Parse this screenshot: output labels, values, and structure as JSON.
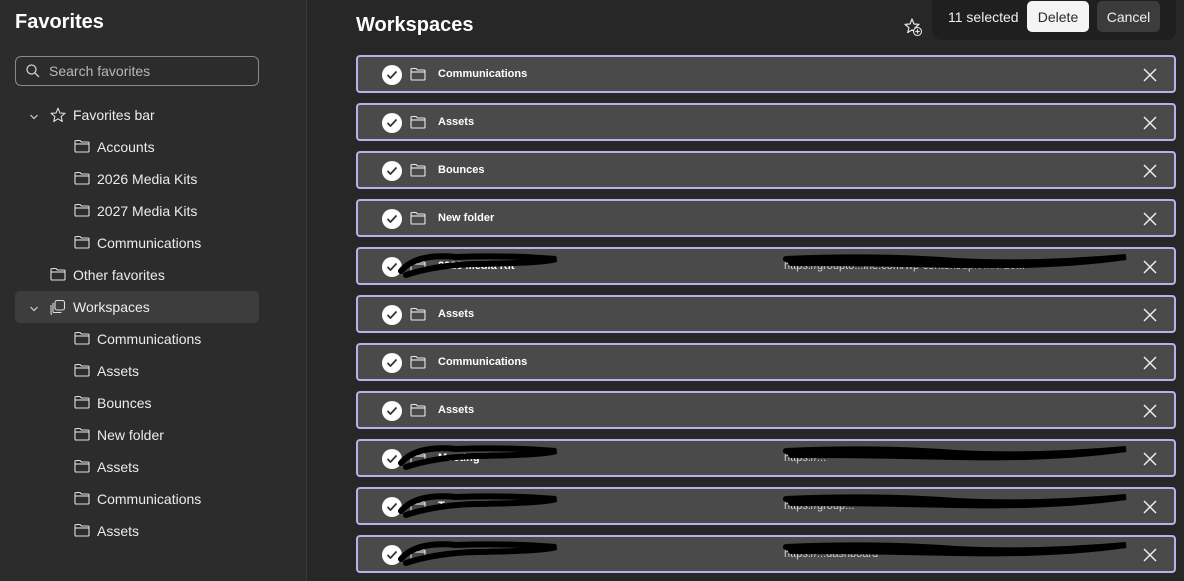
{
  "sidebar": {
    "title": "Favorites",
    "search_placeholder": "Search favorites",
    "tree": [
      {
        "label": "Favorites bar",
        "icon": "star-icon",
        "level": 0,
        "expanded": true
      },
      {
        "label": "Accounts",
        "icon": "folder-icon",
        "level": 1
      },
      {
        "label": "2026 Media Kits",
        "icon": "folder-icon",
        "level": 1
      },
      {
        "label": "2027 Media Kits",
        "icon": "folder-icon",
        "level": 1
      },
      {
        "label": "Communications",
        "icon": "folder-icon",
        "level": 1
      },
      {
        "label": "Other favorites",
        "icon": "folder-icon",
        "level": 0
      },
      {
        "label": "Workspaces",
        "icon": "workspaces-icon",
        "level": 0,
        "expanded": true,
        "selected": true
      },
      {
        "label": "Communications",
        "icon": "folder-icon",
        "level": 1
      },
      {
        "label": "Assets",
        "icon": "folder-icon",
        "level": 1
      },
      {
        "label": "Bounces",
        "icon": "folder-icon",
        "level": 1
      },
      {
        "label": "New folder",
        "icon": "folder-icon",
        "level": 1
      },
      {
        "label": "Assets",
        "icon": "folder-icon",
        "level": 1
      },
      {
        "label": "Communications",
        "icon": "folder-icon",
        "level": 1
      },
      {
        "label": "Assets",
        "icon": "folder-icon",
        "level": 1
      }
    ]
  },
  "main": {
    "title": "Workspaces",
    "selection": {
      "count_label": "11 selected",
      "delete_label": "Delete",
      "cancel_label": "Cancel"
    },
    "rows": [
      {
        "name": "Communications",
        "type": "folder",
        "url": ""
      },
      {
        "name": "Assets",
        "type": "folder",
        "url": ""
      },
      {
        "name": "Bounces",
        "type": "folder",
        "url": ""
      },
      {
        "name": "New folder",
        "type": "folder",
        "url": ""
      },
      {
        "name": "2026 Media Kit",
        "type": "link",
        "url": "https://groupto...ine.com/wp-content/uploads/20...",
        "redacted": true
      },
      {
        "name": "Assets",
        "type": "folder",
        "url": ""
      },
      {
        "name": "Communications",
        "type": "folder",
        "url": ""
      },
      {
        "name": "Assets",
        "type": "folder",
        "url": ""
      },
      {
        "name": "Meeting",
        "type": "link",
        "url": "https://...",
        "redacted": true
      },
      {
        "name": "Te",
        "type": "link",
        "url": "https://group...",
        "redacted": true
      },
      {
        "name": "",
        "type": "link",
        "url": "https://...dashboard",
        "redacted": true
      }
    ]
  },
  "colors": {
    "row_border": "#b4b2ec",
    "row_bg": "#4a4a4a",
    "page_bg": "#272727",
    "sidebar_bg": "#2c2c2c"
  }
}
